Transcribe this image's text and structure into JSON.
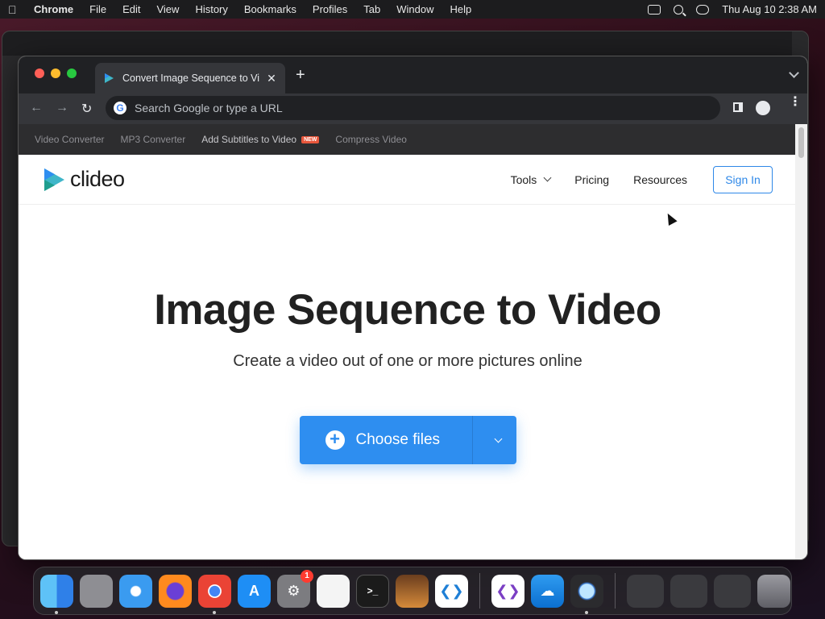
{
  "menubar": {
    "app": "Chrome",
    "items": [
      "File",
      "Edit",
      "View",
      "History",
      "Bookmarks",
      "Profiles",
      "Tab",
      "Window",
      "Help"
    ],
    "clock": "Thu Aug 10  2:38 AM"
  },
  "browser": {
    "tab_title": "Convert Image Sequence to Vi",
    "omnibox_placeholder": "Search Google or type a URL",
    "accent": "#2e8ef0"
  },
  "site": {
    "top_links": [
      {
        "label": "Video Converter"
      },
      {
        "label": "MP3 Converter"
      },
      {
        "label": "Add Subtitles to Video",
        "badge": "NEW"
      },
      {
        "label": "Compress Video"
      }
    ],
    "logo": "clideo",
    "nav": {
      "tools": "Tools",
      "pricing": "Pricing",
      "resources": "Resources",
      "signin": "Sign In"
    },
    "hero": {
      "title": "Image Sequence to Video",
      "subtitle": "Create a video out of one or more pictures online",
      "button": "Choose files"
    }
  },
  "dock": {
    "apps": [
      "finder-icon",
      "launchpad-icon",
      "safari-icon",
      "firefox-icon",
      "chrome-icon",
      "app-store-icon",
      "system-settings-icon",
      "textedit-icon",
      "terminal-icon",
      "garageband-icon",
      "vscode-icon",
      "visual-studio-icon",
      "icloud-icon",
      "quicktime-icon"
    ],
    "settings_badge": "1"
  }
}
